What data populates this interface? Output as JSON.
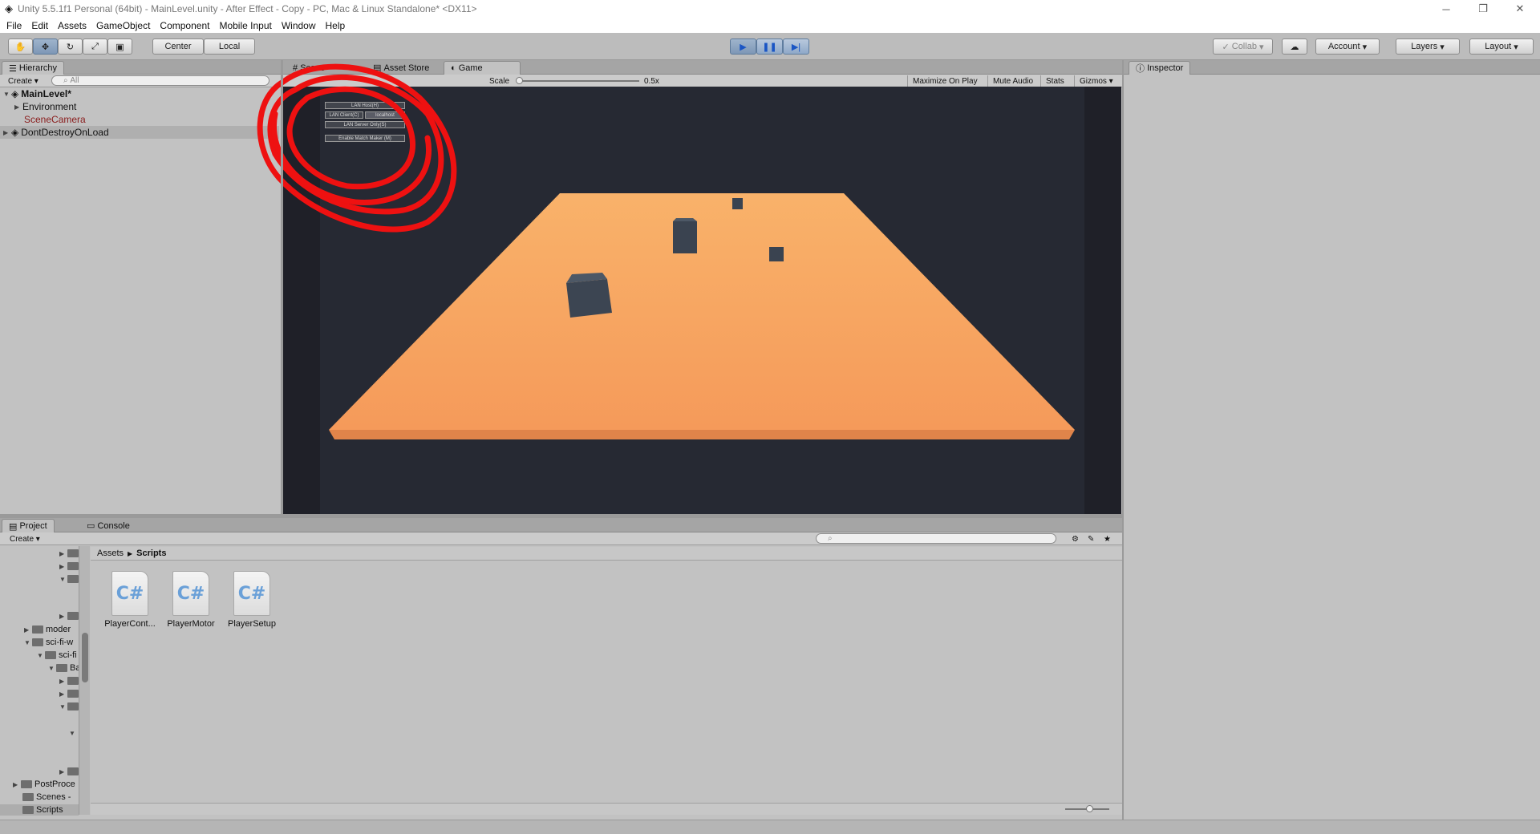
{
  "window": {
    "title": "Unity 5.5.1f1 Personal (64bit) - MainLevel.unity - After Effect - Copy - PC, Mac & Linux Standalone* <DX11>",
    "minimize": "─",
    "restore": "❐",
    "close": "✕"
  },
  "menu": [
    "File",
    "Edit",
    "Assets",
    "GameObject",
    "Component",
    "Mobile Input",
    "Window",
    "Help"
  ],
  "toolbar": {
    "center_label": "Center",
    "local_label": "Local",
    "collab_label": "Collab",
    "account_label": "Account",
    "layers_label": "Layers",
    "layout_label": "Layout"
  },
  "hierarchy": {
    "tab": "Hierarchy",
    "create": "Create",
    "search_placeholder": "All",
    "rows": [
      "MainLevel*",
      "Environment",
      "SceneCamera",
      "DontDestroyOnLoad"
    ]
  },
  "center_tabs": {
    "scene": "Scene",
    "asset_store": "Asset Store",
    "game": "Game"
  },
  "game_bar": {
    "scale_label": "Scale",
    "scale_value": "0.5x",
    "maximize": "Maximize On Play",
    "mute": "Mute Audio",
    "stats": "Stats",
    "gizmos": "Gizmos"
  },
  "net_hud": {
    "lan_host": "LAN Host(H)",
    "lan_client": "LAN Client(C)",
    "client_field": "localhost",
    "lan_server": "LAN Server Only(S)",
    "matchmaker": "Enable Match Maker (M)"
  },
  "inspector": {
    "tab": "Inspector"
  },
  "project": {
    "tab": "Project",
    "console_tab": "Console",
    "create": "Create",
    "breadcrumb": [
      "Assets",
      "Scripts"
    ],
    "tree": [
      "moder",
      "sci-fi-w",
      "sci-fi",
      "Ba",
      "PostProce",
      "Scenes -",
      "Scripts"
    ],
    "assets": [
      "PlayerCont...",
      "PlayerMotor",
      "PlayerSetup"
    ],
    "asset_icon": "C#"
  },
  "colors": {
    "floor": "#f7a563",
    "game_bg": "#262933",
    "annotation": "#ee1111",
    "play_blue": "#1a55c4"
  }
}
